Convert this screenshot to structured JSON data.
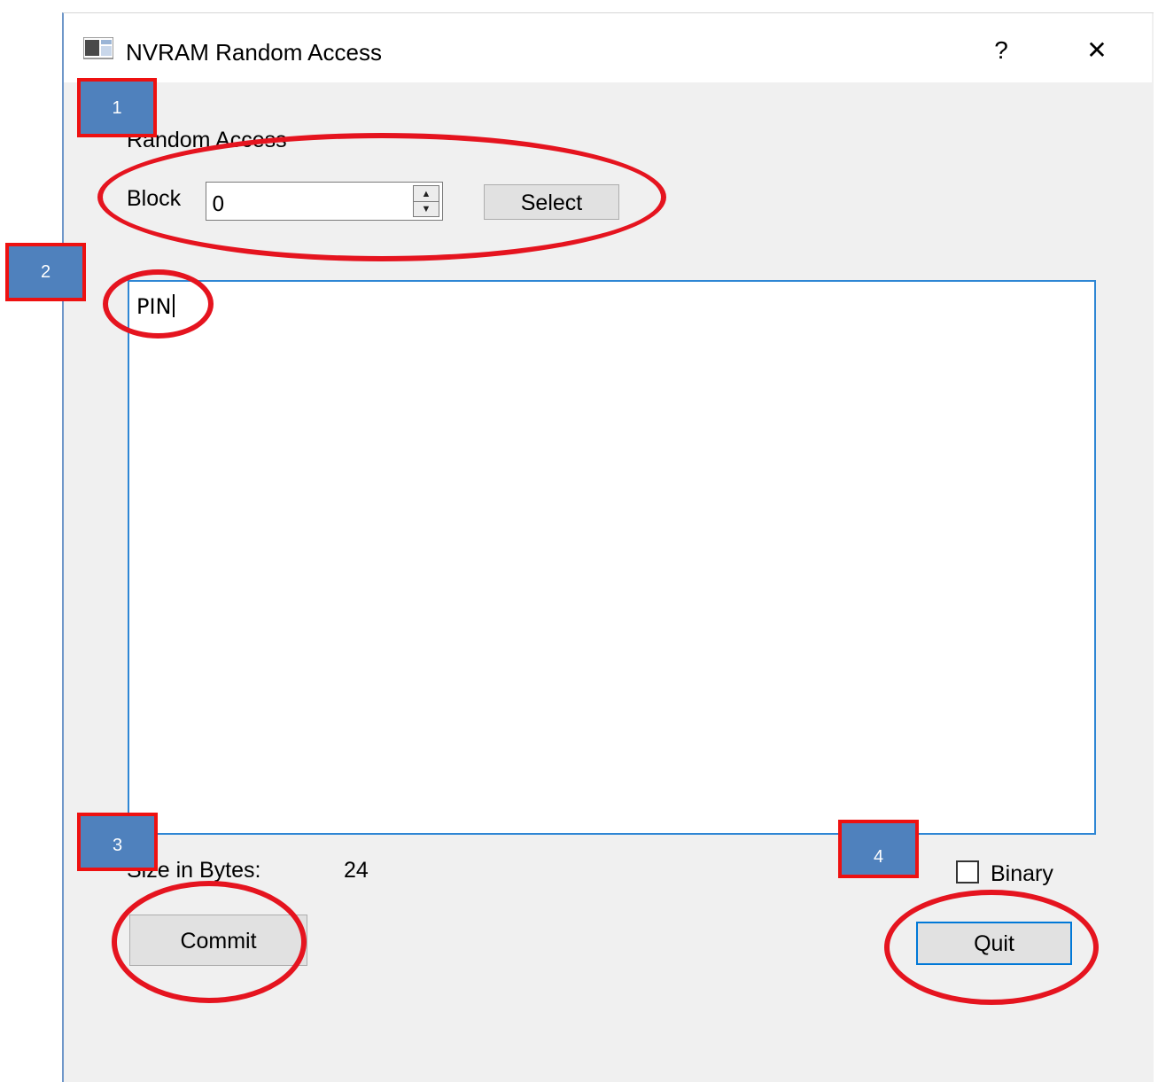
{
  "window": {
    "title": "NVRAM Random Access",
    "help_label": "?",
    "close_label": "✕",
    "app_icon": "window-app-icon"
  },
  "form": {
    "group_label": "Random Access",
    "block_label": "Block",
    "block_value": "0",
    "select_label": "Select",
    "editor_text": "PIN",
    "size_label": "Size in Bytes:",
    "size_value": "24",
    "binary_label": "Binary",
    "binary_checked": false,
    "commit_label": "Commit",
    "quit_label": "Quit"
  },
  "annotations": {
    "markers": [
      "1",
      "2",
      "3",
      "4"
    ],
    "ellipse_color": "#e5141f",
    "marker_color": "#4f81bd",
    "marker_border": "#ee1111"
  },
  "colors": {
    "window_bg": "#f0f0f0",
    "focus_border": "#0078d7"
  }
}
